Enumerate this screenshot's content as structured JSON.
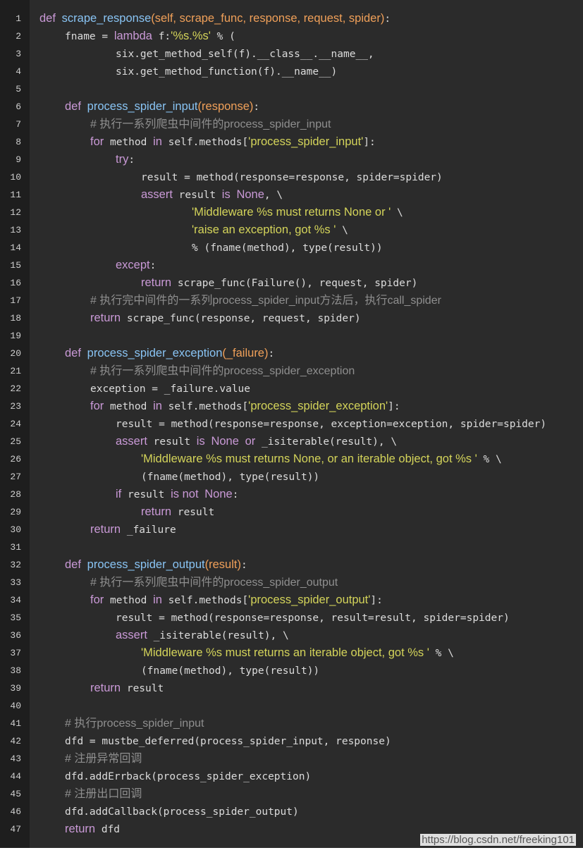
{
  "colors": {
    "background": "#2b2b2b",
    "gutter": "#1e1e1e",
    "keyword": "#c999d6",
    "function": "#89c4f4",
    "parameter": "#f0a059",
    "string": "#d4d45a",
    "comment": "#8f8f8f",
    "plain": "#dcdcdc"
  },
  "watermark": "https://blog.csdn.net/freeking101",
  "lines": [
    {
      "num": "1",
      "indent": 0,
      "tokens": [
        [
          "kw",
          "def"
        ],
        [
          "plain",
          " "
        ],
        [
          "fn",
          "scrape_response"
        ],
        [
          "param",
          "(self, scrape_func, response, request, spider)"
        ],
        [
          "plain",
          ":"
        ]
      ]
    },
    {
      "num": "2",
      "indent": 1,
      "tokens": [
        [
          "plain",
          "fname = "
        ],
        [
          "kw",
          "lambda"
        ],
        [
          "plain",
          " f:"
        ],
        [
          "str",
          "'%s.%s'"
        ],
        [
          "plain",
          " % ("
        ]
      ]
    },
    {
      "num": "3",
      "indent": 3,
      "tokens": [
        [
          "plain",
          "six.get_method_self(f).__class__.__name__,"
        ]
      ]
    },
    {
      "num": "4",
      "indent": 3,
      "tokens": [
        [
          "plain",
          "six.get_method_function(f).__name__)"
        ]
      ]
    },
    {
      "num": "5",
      "indent": 0,
      "tokens": []
    },
    {
      "num": "6",
      "indent": 1,
      "tokens": [
        [
          "kw",
          "def"
        ],
        [
          "plain",
          " "
        ],
        [
          "fn",
          "process_spider_input"
        ],
        [
          "param",
          "(response)"
        ],
        [
          "plain",
          ":"
        ]
      ]
    },
    {
      "num": "7",
      "indent": 2,
      "tokens": [
        [
          "cmt",
          "# 执行一系列爬虫中间件的process_spider_input"
        ]
      ]
    },
    {
      "num": "8",
      "indent": 2,
      "tokens": [
        [
          "kw",
          "for"
        ],
        [
          "plain",
          " method "
        ],
        [
          "kw",
          "in"
        ],
        [
          "plain",
          " self.methods["
        ],
        [
          "str",
          "'process_spider_input'"
        ],
        [
          "plain",
          "]:"
        ]
      ]
    },
    {
      "num": "9",
      "indent": 3,
      "tokens": [
        [
          "kw",
          "try"
        ],
        [
          "plain",
          ":"
        ]
      ]
    },
    {
      "num": "10",
      "indent": 4,
      "tokens": [
        [
          "plain",
          "result = method(response=response, spider=spider)"
        ]
      ]
    },
    {
      "num": "11",
      "indent": 4,
      "tokens": [
        [
          "kw",
          "assert"
        ],
        [
          "plain",
          " result "
        ],
        [
          "kw",
          "is"
        ],
        [
          "plain",
          " "
        ],
        [
          "kw",
          "None"
        ],
        [
          "plain",
          ", \\"
        ]
      ]
    },
    {
      "num": "12",
      "indent": 6,
      "tokens": [
        [
          "str",
          "'Middleware %s must returns None or '"
        ],
        [
          "plain",
          " \\"
        ]
      ]
    },
    {
      "num": "13",
      "indent": 6,
      "tokens": [
        [
          "str",
          "'raise an exception, got %s '"
        ],
        [
          "plain",
          " \\"
        ]
      ]
    },
    {
      "num": "14",
      "indent": 6,
      "tokens": [
        [
          "plain",
          "% (fname(method), type(result))"
        ]
      ]
    },
    {
      "num": "15",
      "indent": 3,
      "tokens": [
        [
          "kw",
          "except"
        ],
        [
          "plain",
          ":"
        ]
      ]
    },
    {
      "num": "16",
      "indent": 4,
      "tokens": [
        [
          "kw",
          "return"
        ],
        [
          "plain",
          " scrape_func(Failure(), request, spider)"
        ]
      ]
    },
    {
      "num": "17",
      "indent": 2,
      "tokens": [
        [
          "cmt",
          "# 执行完中间件的一系列process_spider_input方法后，执行call_spider"
        ]
      ]
    },
    {
      "num": "18",
      "indent": 2,
      "tokens": [
        [
          "kw",
          "return"
        ],
        [
          "plain",
          " scrape_func(response, request, spider)"
        ]
      ]
    },
    {
      "num": "19",
      "indent": 0,
      "tokens": []
    },
    {
      "num": "20",
      "indent": 1,
      "tokens": [
        [
          "kw",
          "def"
        ],
        [
          "plain",
          " "
        ],
        [
          "fn",
          "process_spider_exception"
        ],
        [
          "param",
          "(_failure)"
        ],
        [
          "plain",
          ":"
        ]
      ]
    },
    {
      "num": "21",
      "indent": 2,
      "tokens": [
        [
          "cmt",
          "# 执行一系列爬虫中间件的process_spider_exception"
        ]
      ]
    },
    {
      "num": "22",
      "indent": 2,
      "tokens": [
        [
          "plain",
          "exception = _failure.value"
        ]
      ]
    },
    {
      "num": "23",
      "indent": 2,
      "tokens": [
        [
          "kw",
          "for"
        ],
        [
          "plain",
          " method "
        ],
        [
          "kw",
          "in"
        ],
        [
          "plain",
          " self.methods["
        ],
        [
          "str",
          "'process_spider_exception'"
        ],
        [
          "plain",
          "]:"
        ]
      ]
    },
    {
      "num": "24",
      "indent": 3,
      "tokens": [
        [
          "plain",
          "result = method(response=response, exception=exception, spider=spider)"
        ]
      ]
    },
    {
      "num": "25",
      "indent": 3,
      "tokens": [
        [
          "kw",
          "assert"
        ],
        [
          "plain",
          " result "
        ],
        [
          "kw",
          "is"
        ],
        [
          "plain",
          " "
        ],
        [
          "kw",
          "None"
        ],
        [
          "plain",
          " "
        ],
        [
          "kw",
          "or"
        ],
        [
          "plain",
          " _isiterable(result), \\"
        ]
      ]
    },
    {
      "num": "26",
      "indent": 4,
      "tokens": [
        [
          "str",
          "'Middleware %s must returns None, or an iterable object, got %s '"
        ],
        [
          "plain",
          " % \\"
        ]
      ]
    },
    {
      "num": "27",
      "indent": 4,
      "tokens": [
        [
          "plain",
          "(fname(method), type(result))"
        ]
      ]
    },
    {
      "num": "28",
      "indent": 3,
      "tokens": [
        [
          "kw",
          "if"
        ],
        [
          "plain",
          " result "
        ],
        [
          "kw",
          "is not"
        ],
        [
          "plain",
          " "
        ],
        [
          "kw",
          "None"
        ],
        [
          "plain",
          ":"
        ]
      ]
    },
    {
      "num": "29",
      "indent": 4,
      "tokens": [
        [
          "kw",
          "return"
        ],
        [
          "plain",
          " result"
        ]
      ]
    },
    {
      "num": "30",
      "indent": 2,
      "tokens": [
        [
          "kw",
          "return"
        ],
        [
          "plain",
          " _failure"
        ]
      ]
    },
    {
      "num": "31",
      "indent": 0,
      "tokens": []
    },
    {
      "num": "32",
      "indent": 1,
      "tokens": [
        [
          "kw",
          "def"
        ],
        [
          "plain",
          " "
        ],
        [
          "fn",
          "process_spider_output"
        ],
        [
          "param",
          "(result)"
        ],
        [
          "plain",
          ":"
        ]
      ]
    },
    {
      "num": "33",
      "indent": 2,
      "tokens": [
        [
          "cmt",
          "# 执行一系列爬虫中间件的process_spider_output"
        ]
      ]
    },
    {
      "num": "34",
      "indent": 2,
      "tokens": [
        [
          "kw",
          "for"
        ],
        [
          "plain",
          " method "
        ],
        [
          "kw",
          "in"
        ],
        [
          "plain",
          " self.methods["
        ],
        [
          "str",
          "'process_spider_output'"
        ],
        [
          "plain",
          "]:"
        ]
      ]
    },
    {
      "num": "35",
      "indent": 3,
      "tokens": [
        [
          "plain",
          "result = method(response=response, result=result, spider=spider)"
        ]
      ]
    },
    {
      "num": "36",
      "indent": 3,
      "tokens": [
        [
          "kw",
          "assert"
        ],
        [
          "plain",
          " _isiterable(result), \\"
        ]
      ]
    },
    {
      "num": "37",
      "indent": 4,
      "tokens": [
        [
          "str",
          "'Middleware %s must returns an iterable object, got %s '"
        ],
        [
          "plain",
          " % \\"
        ]
      ]
    },
    {
      "num": "38",
      "indent": 4,
      "tokens": [
        [
          "plain",
          "(fname(method), type(result))"
        ]
      ]
    },
    {
      "num": "39",
      "indent": 2,
      "tokens": [
        [
          "kw",
          "return"
        ],
        [
          "plain",
          " result"
        ]
      ]
    },
    {
      "num": "40",
      "indent": 0,
      "tokens": []
    },
    {
      "num": "41",
      "indent": 1,
      "tokens": [
        [
          "cmt",
          "# 执行process_spider_input"
        ]
      ]
    },
    {
      "num": "42",
      "indent": 1,
      "tokens": [
        [
          "plain",
          "dfd = mustbe_deferred(process_spider_input, response)"
        ]
      ]
    },
    {
      "num": "43",
      "indent": 1,
      "tokens": [
        [
          "cmt",
          "# 注册异常回调"
        ]
      ]
    },
    {
      "num": "44",
      "indent": 1,
      "tokens": [
        [
          "plain",
          "dfd.addErrback(process_spider_exception)"
        ]
      ]
    },
    {
      "num": "45",
      "indent": 1,
      "tokens": [
        [
          "cmt",
          "# 注册出口回调"
        ]
      ]
    },
    {
      "num": "46",
      "indent": 1,
      "tokens": [
        [
          "plain",
          "dfd.addCallback(process_spider_output)"
        ]
      ]
    },
    {
      "num": "47",
      "indent": 1,
      "tokens": [
        [
          "kw",
          "return"
        ],
        [
          "plain",
          " dfd"
        ]
      ]
    }
  ]
}
